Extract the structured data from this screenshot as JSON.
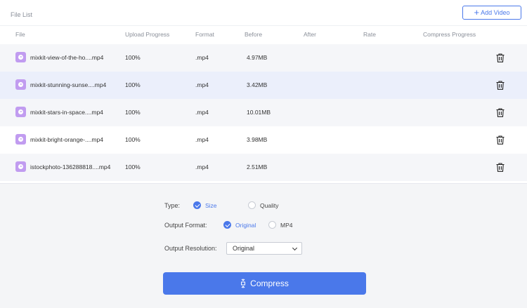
{
  "file_list": {
    "title": "File List",
    "add_button_label": "Add Video",
    "columns": [
      "File",
      "Upload Progress",
      "Format",
      "Before",
      "After",
      "Rate",
      "Compress Progress"
    ],
    "rows": [
      {
        "name": "mixkit-view-of-the-ho....mp4",
        "progress": "100%",
        "format": ".mp4",
        "before": "4.97MB",
        "after": "",
        "rate": "",
        "compress_progress": ""
      },
      {
        "name": "mixkit-stunning-sunse....mp4",
        "progress": "100%",
        "format": ".mp4",
        "before": "3.42MB",
        "after": "",
        "rate": "",
        "compress_progress": ""
      },
      {
        "name": "mixkit-stars-in-space....mp4",
        "progress": "100%",
        "format": ".mp4",
        "before": "10.01MB",
        "after": "",
        "rate": "",
        "compress_progress": ""
      },
      {
        "name": "mixkit-bright-orange-....mp4",
        "progress": "100%",
        "format": ".mp4",
        "before": "3.98MB",
        "after": "",
        "rate": "",
        "compress_progress": ""
      },
      {
        "name": "istockphoto-136288818....mp4",
        "progress": "100%",
        "format": ".mp4",
        "before": "2.51MB",
        "after": "",
        "rate": "",
        "compress_progress": ""
      }
    ]
  },
  "settings": {
    "type_label": "Type:",
    "type_options": [
      {
        "label": "Size",
        "checked": true
      },
      {
        "label": "Quality",
        "checked": false
      }
    ],
    "output_format_label": "Output Format:",
    "output_format_options": [
      {
        "label": "Original",
        "checked": true
      },
      {
        "label": "MP4",
        "checked": false
      }
    ],
    "output_resolution_label": "Output Resolution:",
    "output_resolution_value": "Original",
    "compress_label": "Compress"
  },
  "colors": {
    "accent": "#4a78ea",
    "file_icon": "#c19cf0",
    "selected_row": "#ebeffb"
  },
  "icons": {
    "add": "plus-icon",
    "file": "video-file-icon",
    "delete": "trash-icon",
    "compress": "compress-icon",
    "dropdown": "chevron-down-icon"
  }
}
